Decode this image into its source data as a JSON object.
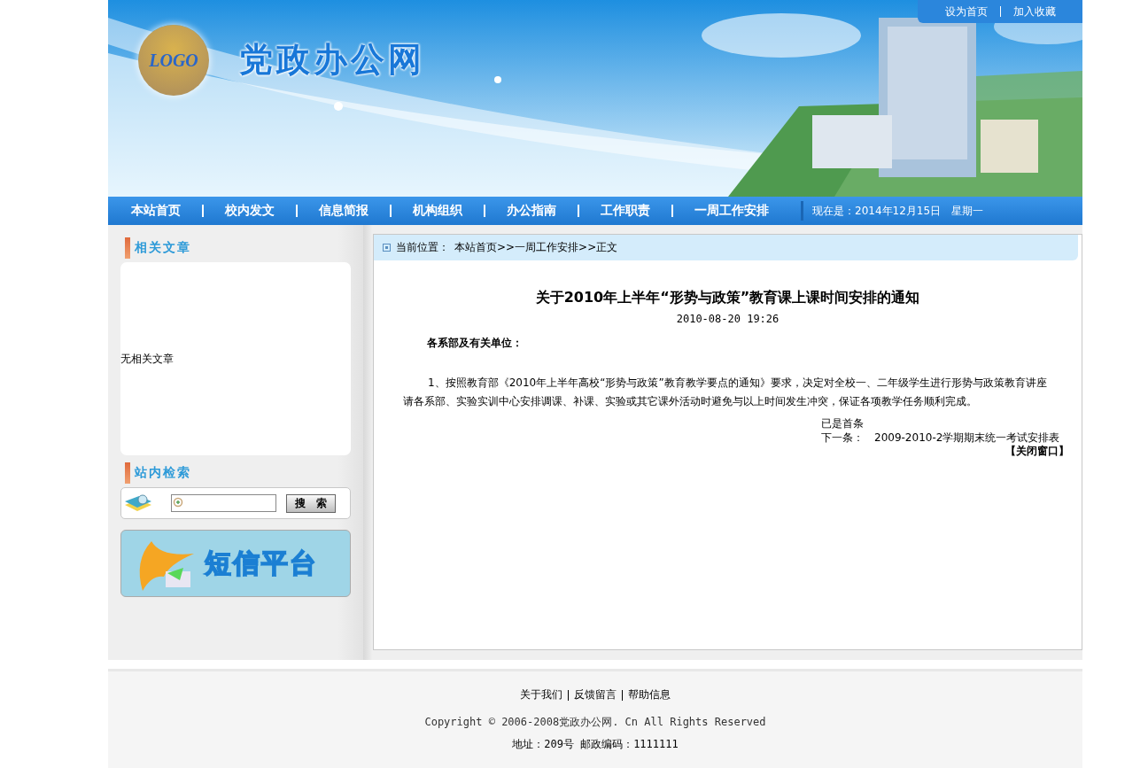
{
  "header": {
    "logo": "LOGO",
    "site_title": "党政办公网",
    "top_links": [
      "设为首页",
      "加入收藏"
    ]
  },
  "nav": {
    "items": [
      {
        "label": "本站首页"
      },
      {
        "label": "校内发文"
      },
      {
        "label": "信息简报"
      },
      {
        "label": "机构组织"
      },
      {
        "label": "办公指南"
      },
      {
        "label": "工作职责"
      },
      {
        "label": "一周工作安排"
      }
    ],
    "date": "现在是：2014年12月15日　星期一"
  },
  "sidebar": {
    "related": {
      "title": "相关文章",
      "empty": "无相关文章"
    },
    "search": {
      "title": "站内检索",
      "button": "搜　索"
    },
    "sms_banner": "短信平台"
  },
  "breadcrumb": {
    "label": "当前位置：",
    "path": "本站首页>>一周工作安排>>正文"
  },
  "article": {
    "title": "关于2010年上半年“形势与政策”教育课上课时间安排的通知",
    "date": "2010-08-20 19:26",
    "salutation": "各系部及有关单位：",
    "body": "1、按照教育部《2010年上半年高校“形势与政策”教育教学要点的通知》要求，决定对全校一、二年级学生进行形势与政策教育讲座请各系部、实验实训中心安排调课、补课、实验或其它课外活动时避免与以上时间发生冲突，保证各项教学任务顺利完成。",
    "prev": "已是首条",
    "next_label": "下一条：",
    "next": "2009-2010-2学期期末统一考试安排表",
    "close": "【关闭窗口】"
  },
  "footer": {
    "links": [
      "关于我们",
      "反馈留言",
      "帮助信息"
    ],
    "copyright": "Copyright © 2006-2008党政办公网. Cn All Rights Reserved",
    "address": "地址：209号 邮政编码：1111111"
  }
}
